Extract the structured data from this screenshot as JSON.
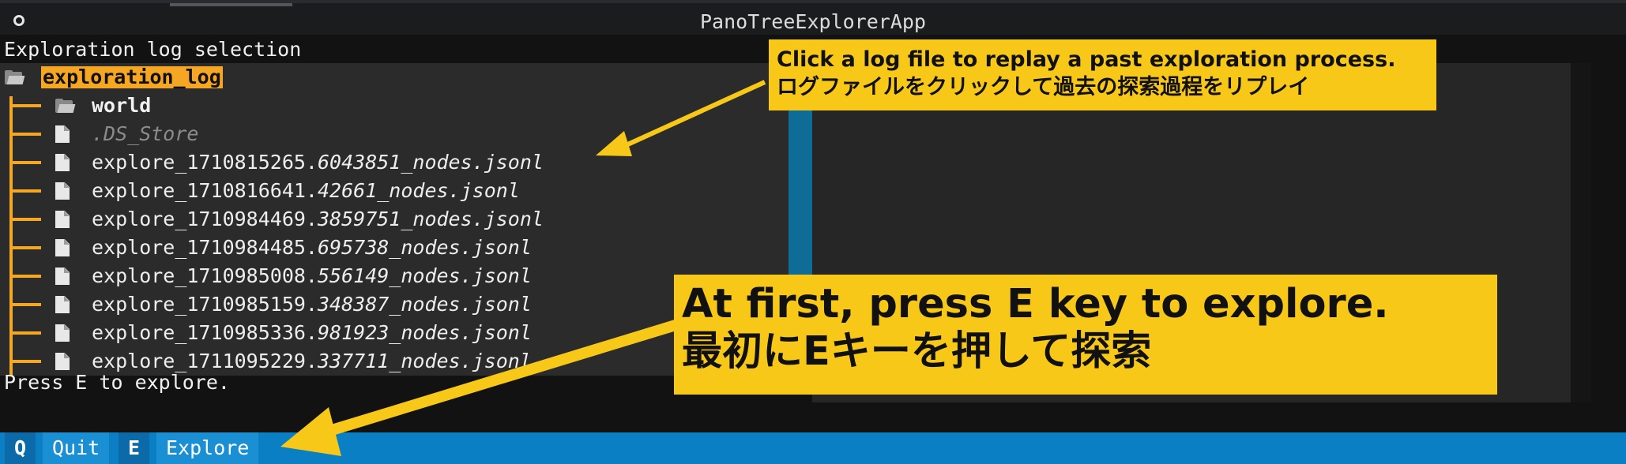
{
  "window": {
    "title": "PanoTreeExplorerApp"
  },
  "panel": {
    "label": "Exploration log selection"
  },
  "tree": {
    "root": "exploration_log",
    "folder": "world",
    "hidden_file": ".DS_Store",
    "files": [
      {
        "prefix": "explore_1710815265.",
        "suffix": "6043851_nodes.jsonl"
      },
      {
        "prefix": "explore_1710816641.",
        "suffix": "42661_nodes.jsonl"
      },
      {
        "prefix": "explore_1710984469.",
        "suffix": "3859751_nodes.jsonl"
      },
      {
        "prefix": "explore_1710984485.",
        "suffix": "695738_nodes.jsonl"
      },
      {
        "prefix": "explore_1710985008.",
        "suffix": "556149_nodes.jsonl"
      },
      {
        "prefix": "explore_1710985159.",
        "suffix": "348387_nodes.jsonl"
      },
      {
        "prefix": "explore_1710985336.",
        "suffix": "981923_nodes.jsonl"
      },
      {
        "prefix": "explore_1711095229.",
        "suffix": "337711_nodes.jsonl"
      }
    ]
  },
  "status": {
    "text": "Press E to explore."
  },
  "footer": {
    "quit_key": "Q",
    "quit_label": "Quit",
    "explore_key": "E",
    "explore_label": "Explore"
  },
  "annotations": {
    "top_line1": "Click a log file to replay a past exploration process.",
    "top_line2": "ログファイルをクリックして過去の探索過程をリプレイ",
    "bottom_line1": "At first, press E key to explore.",
    "bottom_line2": "最初にEキーを押して探索"
  },
  "colors": {
    "accent_orange": "#f5a623",
    "callout_yellow": "#f8c819",
    "footer_blue": "#0a7fc4",
    "scroll_blue": "#0f6c96"
  }
}
